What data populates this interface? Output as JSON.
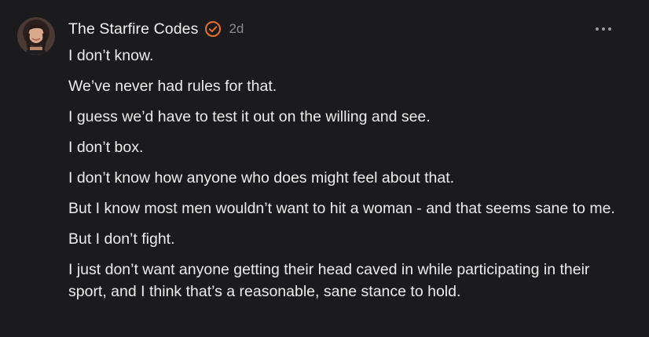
{
  "comment": {
    "author": "The Starfire Codes",
    "timestamp": "2d",
    "paragraphs": [
      "I don’t know.",
      "We’ve never had rules for that.",
      "I guess we’d have to test it out on the willing and see.",
      "I don’t box.",
      "I don’t know how anyone who does might feel about that.",
      "But I know most men wouldn’t want to hit a woman - and that seems sane to me.",
      "But I don’t fight.",
      "I just don’t want anyone getting their head caved in while participating in their sport, and I think that’s a reasonable, sane stance to hold."
    ]
  },
  "icons": {
    "verified": "verified-check-icon",
    "more": "more-options-icon",
    "avatar": "user-avatar"
  },
  "colors": {
    "background": "#1b1b1d",
    "text": "#ececec",
    "muted": "#8b8b8f",
    "accent": "#e8702a"
  }
}
